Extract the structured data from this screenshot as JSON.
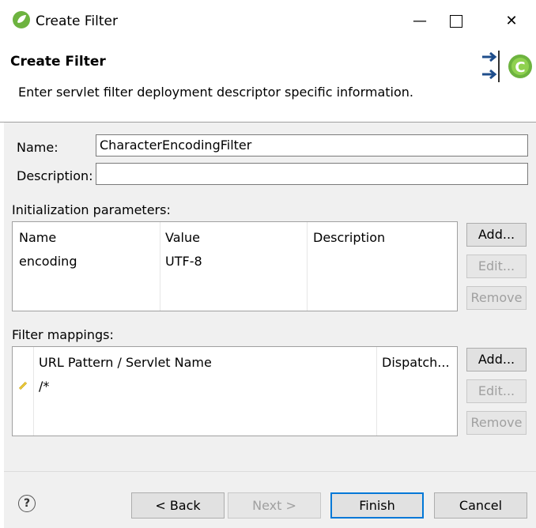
{
  "window": {
    "title": "Create Filter",
    "min_glyph": "—",
    "close_glyph": "✕"
  },
  "banner": {
    "title": "Create Filter",
    "description": "Enter servlet filter deployment descriptor specific information."
  },
  "form": {
    "name_label": "Name:",
    "name_value": "CharacterEncodingFilter",
    "description_label": "Description:",
    "description_value": ""
  },
  "init_params": {
    "section_label": "Initialization parameters:",
    "columns": [
      "Name",
      "Value",
      "Description"
    ],
    "rows": [
      {
        "name": "encoding",
        "value": "UTF-8",
        "description": ""
      }
    ],
    "buttons": {
      "add": "Add...",
      "edit": "Edit...",
      "remove": "Remove"
    }
  },
  "filter_mappings": {
    "section_label": "Filter mappings:",
    "columns": [
      "URL Pattern / Servlet Name",
      "Dispatch..."
    ],
    "rows": [
      {
        "icon": "url-pattern-icon",
        "pattern": "/*",
        "dispatch": ""
      }
    ],
    "buttons": {
      "add": "Add...",
      "edit": "Edit...",
      "remove": "Remove"
    }
  },
  "footer": {
    "help_glyph": "?",
    "back": "< Back",
    "next": "Next >",
    "finish": "Finish",
    "cancel": "Cancel"
  },
  "colors": {
    "focus_border": "#0078d7",
    "spring_green": "#6db33f"
  }
}
